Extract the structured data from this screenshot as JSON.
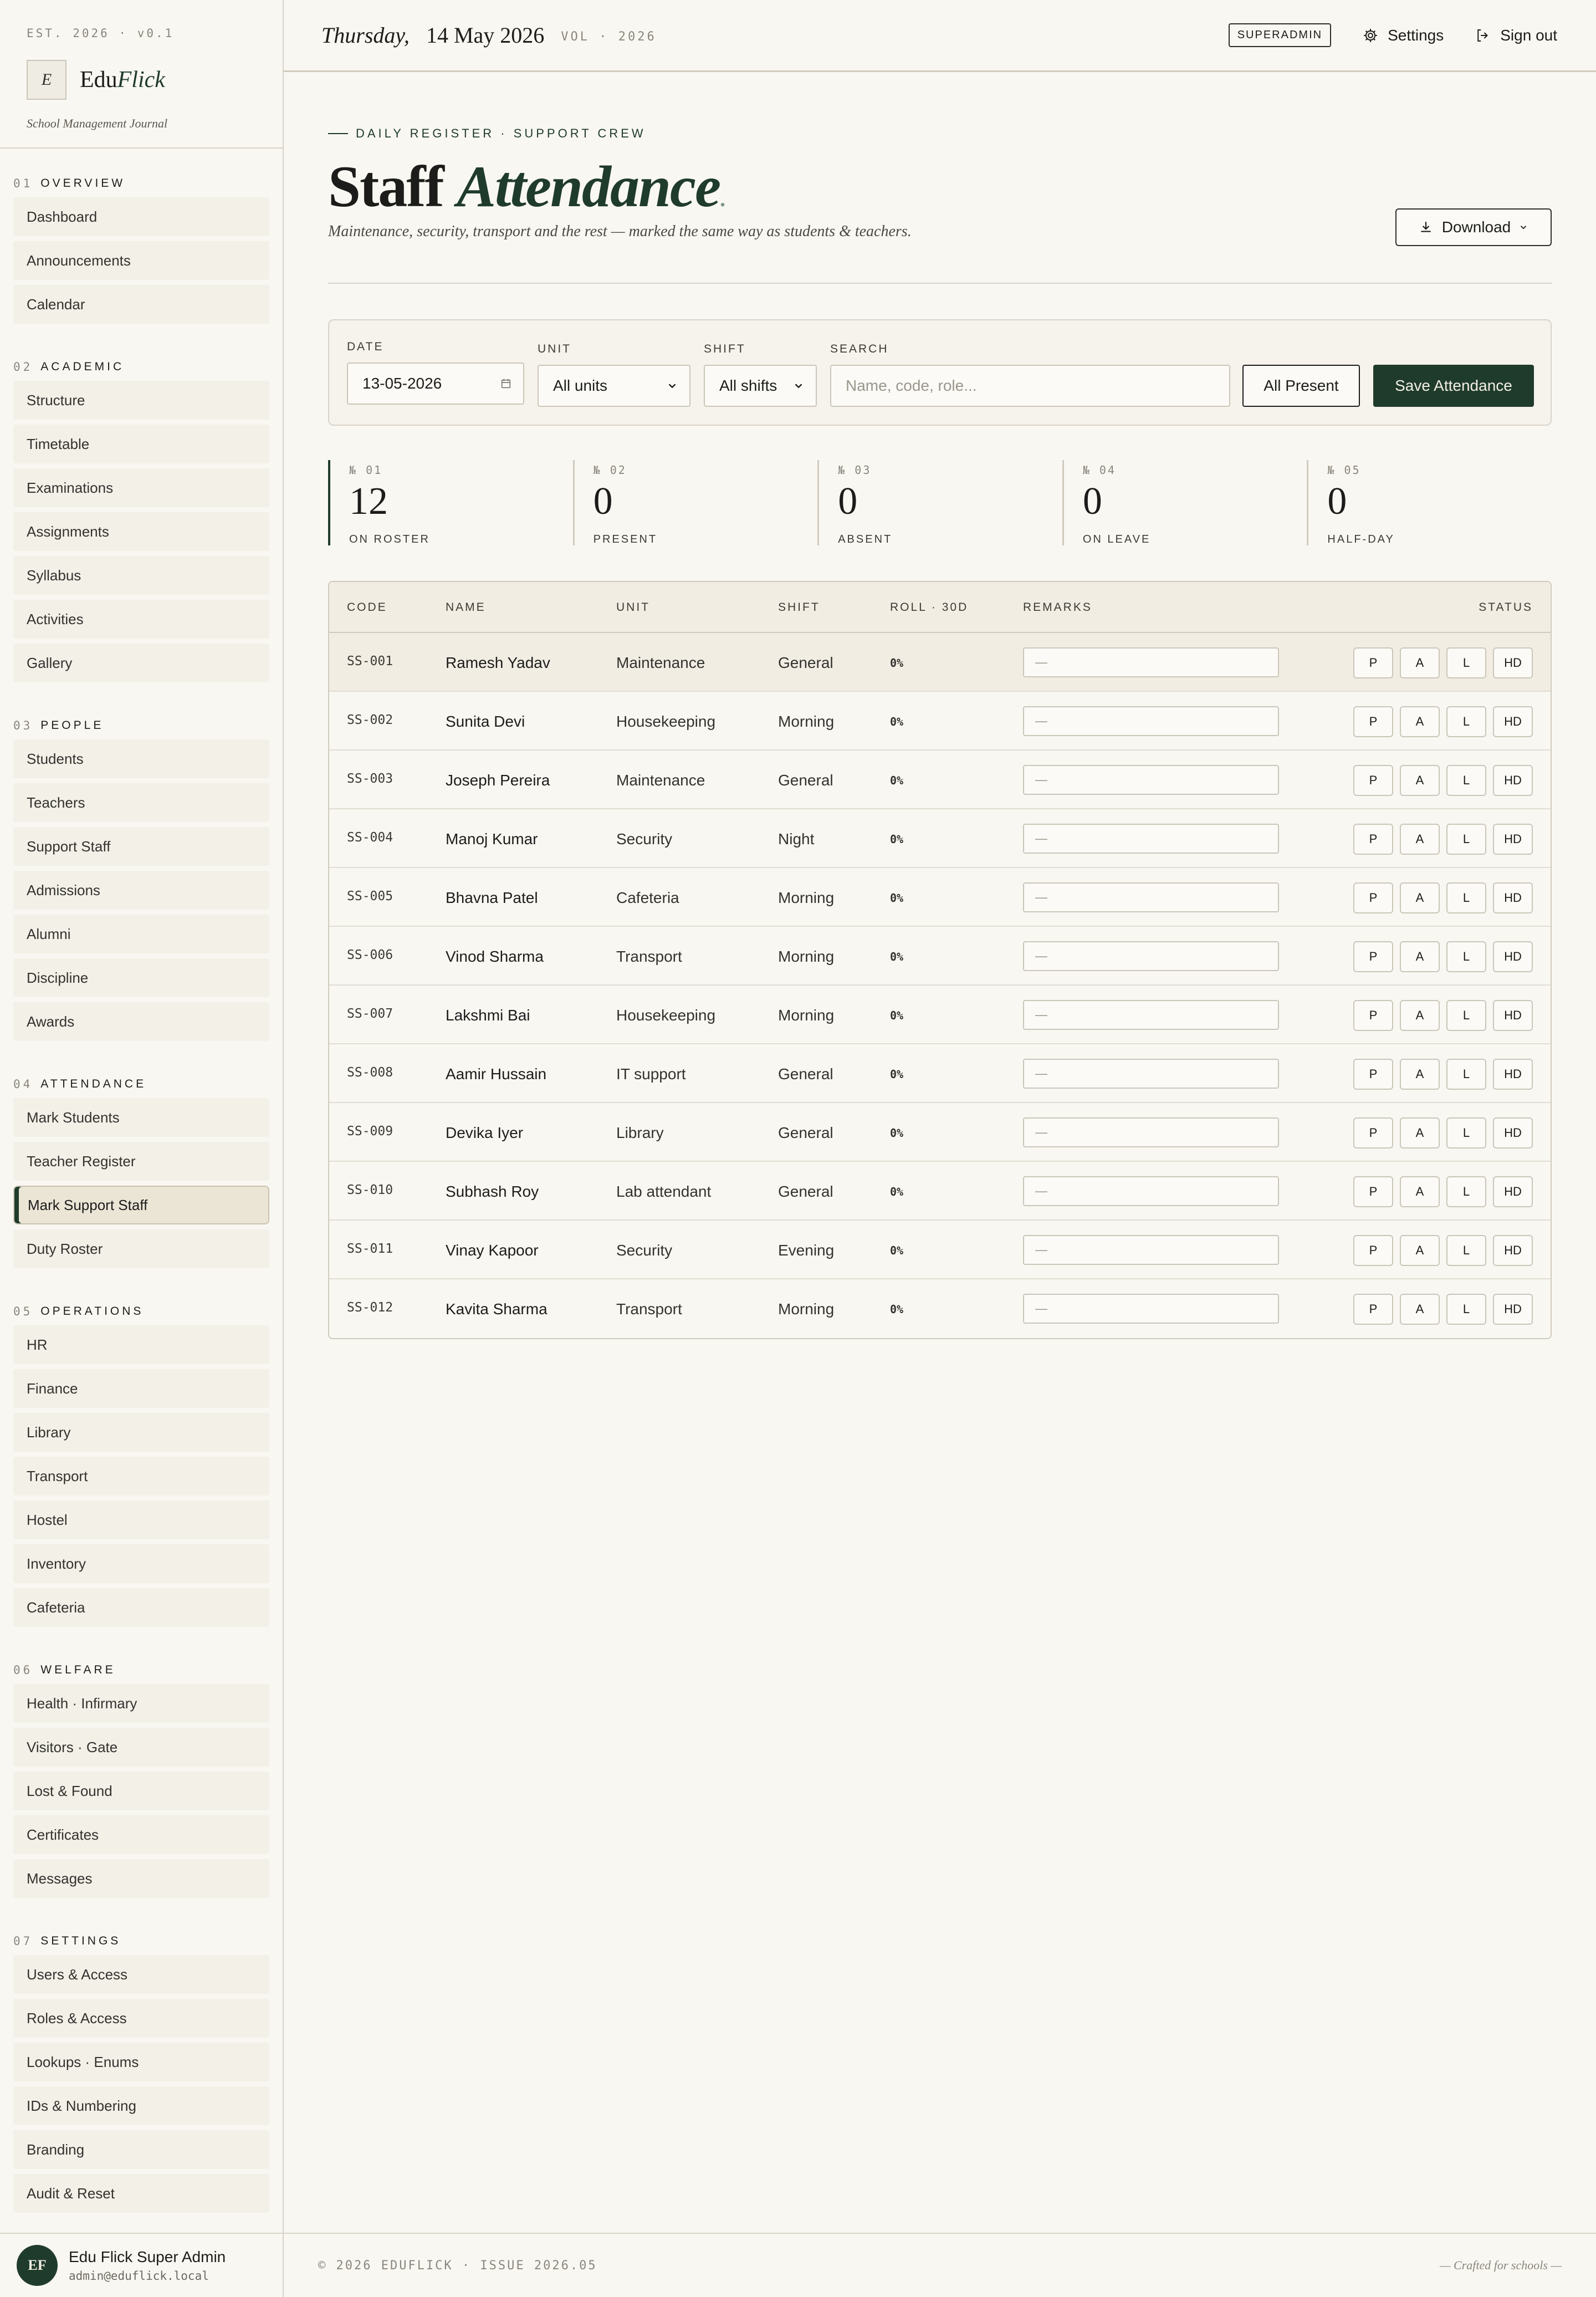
{
  "sidebar": {
    "est": "EST. 2026 · v0.1",
    "logo_letter": "E",
    "brand_main": "Edu",
    "brand_accent": "Flick",
    "brand_sub": "School Management Journal",
    "sections": [
      {
        "num": "01",
        "title": "OVERVIEW",
        "items": [
          "Dashboard",
          "Announcements",
          "Calendar"
        ]
      },
      {
        "num": "02",
        "title": "ACADEMIC",
        "items": [
          "Structure",
          "Timetable",
          "Examinations",
          "Assignments",
          "Syllabus",
          "Activities",
          "Gallery"
        ]
      },
      {
        "num": "03",
        "title": "PEOPLE",
        "items": [
          "Students",
          "Teachers",
          "Support Staff",
          "Admissions",
          "Alumni",
          "Discipline",
          "Awards"
        ]
      },
      {
        "num": "04",
        "title": "ATTENDANCE",
        "items": [
          "Mark Students",
          "Teacher Register",
          "Mark Support Staff",
          "Duty Roster"
        ]
      },
      {
        "num": "05",
        "title": "OPERATIONS",
        "items": [
          "HR",
          "Finance",
          "Library",
          "Transport",
          "Hostel",
          "Inventory",
          "Cafeteria"
        ]
      },
      {
        "num": "06",
        "title": "WELFARE",
        "items": [
          "Health · Infirmary",
          "Visitors · Gate",
          "Lost & Found",
          "Certificates",
          "Messages"
        ]
      },
      {
        "num": "07",
        "title": "SETTINGS",
        "items": [
          "Users & Access",
          "Roles & Access",
          "Lookups · Enums",
          "IDs & Numbering",
          "Branding",
          "Audit & Reset"
        ]
      }
    ],
    "active_item": "Mark Support Staff",
    "user": {
      "initials": "EF",
      "name": "Edu Flick Super Admin",
      "email": "admin@eduflick.local"
    }
  },
  "topbar": {
    "day": "Thursday,",
    "date": "14 May 2026",
    "vol": "VOL · 2026",
    "role": "SUPERADMIN",
    "settings_label": "Settings",
    "signout_label": "Sign out"
  },
  "page": {
    "eyebrow": "DAILY REGISTER · SUPPORT CREW",
    "title_main": "Staff",
    "title_accent": "Attendance",
    "subtitle": "Maintenance, security, transport and the rest — marked the same way as students & teachers.",
    "download_label": "Download"
  },
  "filters": {
    "date_label": "DATE",
    "date_value": "13-05-2026",
    "unit_label": "UNIT",
    "unit_value": "All units",
    "shift_label": "SHIFT",
    "shift_value": "All shifts",
    "search_label": "SEARCH",
    "search_placeholder": "Name, code, role...",
    "all_present_label": "All Present",
    "save_label": "Save Attendance"
  },
  "stats": [
    {
      "num": "№ 01",
      "value": "12",
      "label": "ON ROSTER"
    },
    {
      "num": "№ 02",
      "value": "0",
      "label": "PRESENT"
    },
    {
      "num": "№ 03",
      "value": "0",
      "label": "ABSENT"
    },
    {
      "num": "№ 04",
      "value": "0",
      "label": "ON LEAVE"
    },
    {
      "num": "№ 05",
      "value": "0",
      "label": "HALF-DAY"
    }
  ],
  "table": {
    "headers": {
      "code": "CODE",
      "name": "NAME",
      "unit": "UNIT",
      "shift": "SHIFT",
      "roll": "ROLL · 30D",
      "remarks": "REMARKS",
      "status": "STATUS"
    },
    "remark_placeholder": "—",
    "status_options": [
      "P",
      "A",
      "L",
      "HD"
    ],
    "rows": [
      {
        "code": "SS-001",
        "name": "Ramesh Yadav",
        "unit": "Maintenance",
        "shift": "General",
        "roll": "0%"
      },
      {
        "code": "SS-002",
        "name": "Sunita Devi",
        "unit": "Housekeeping",
        "shift": "Morning",
        "roll": "0%"
      },
      {
        "code": "SS-003",
        "name": "Joseph Pereira",
        "unit": "Maintenance",
        "shift": "General",
        "roll": "0%"
      },
      {
        "code": "SS-004",
        "name": "Manoj Kumar",
        "unit": "Security",
        "shift": "Night",
        "roll": "0%"
      },
      {
        "code": "SS-005",
        "name": "Bhavna Patel",
        "unit": "Cafeteria",
        "shift": "Morning",
        "roll": "0%"
      },
      {
        "code": "SS-006",
        "name": "Vinod Sharma",
        "unit": "Transport",
        "shift": "Morning",
        "roll": "0%"
      },
      {
        "code": "SS-007",
        "name": "Lakshmi Bai",
        "unit": "Housekeeping",
        "shift": "Morning",
        "roll": "0%"
      },
      {
        "code": "SS-008",
        "name": "Aamir Hussain",
        "unit": "IT support",
        "shift": "General",
        "roll": "0%"
      },
      {
        "code": "SS-009",
        "name": "Devika Iyer",
        "unit": "Library",
        "shift": "General",
        "roll": "0%"
      },
      {
        "code": "SS-010",
        "name": "Subhash Roy",
        "unit": "Lab attendant",
        "shift": "General",
        "roll": "0%"
      },
      {
        "code": "SS-011",
        "name": "Vinay Kapoor",
        "unit": "Security",
        "shift": "Evening",
        "roll": "0%"
      },
      {
        "code": "SS-012",
        "name": "Kavita Sharma",
        "unit": "Transport",
        "shift": "Morning",
        "roll": "0%"
      }
    ]
  },
  "footer": {
    "left": "© 2026 EDUFLICK · ISSUE 2026.05",
    "right": "— Crafted for schools —"
  }
}
